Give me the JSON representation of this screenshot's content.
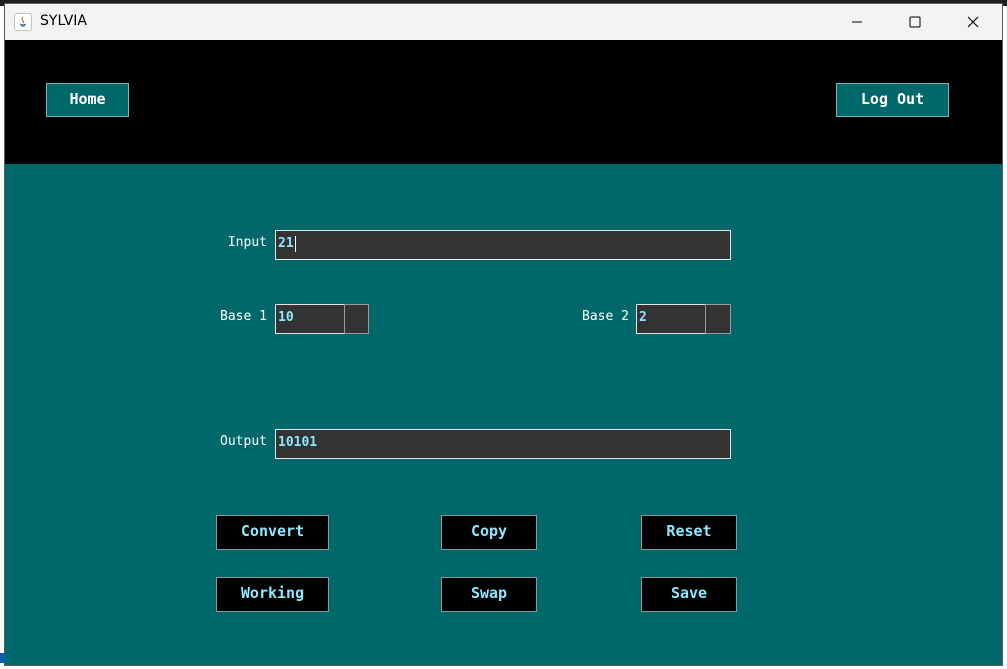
{
  "window": {
    "title": "SYLVIA",
    "icon": "java-icon"
  },
  "header": {
    "home_label": "Home",
    "logout_label": "Log Out"
  },
  "form": {
    "input_label": "Input",
    "input_value": "21",
    "base1_label": "Base 1",
    "base1_value": "10",
    "base2_label": "Base 2",
    "base2_value": "2",
    "output_label": "Output",
    "output_value": "10101"
  },
  "actions": {
    "convert": "Convert",
    "copy": "Copy",
    "reset": "Reset",
    "working": "Working",
    "swap": "Swap",
    "save": "Save"
  },
  "colors": {
    "panel": "#00686a",
    "header": "#000000",
    "field_bg": "#333333",
    "field_text": "#8de7ff"
  }
}
